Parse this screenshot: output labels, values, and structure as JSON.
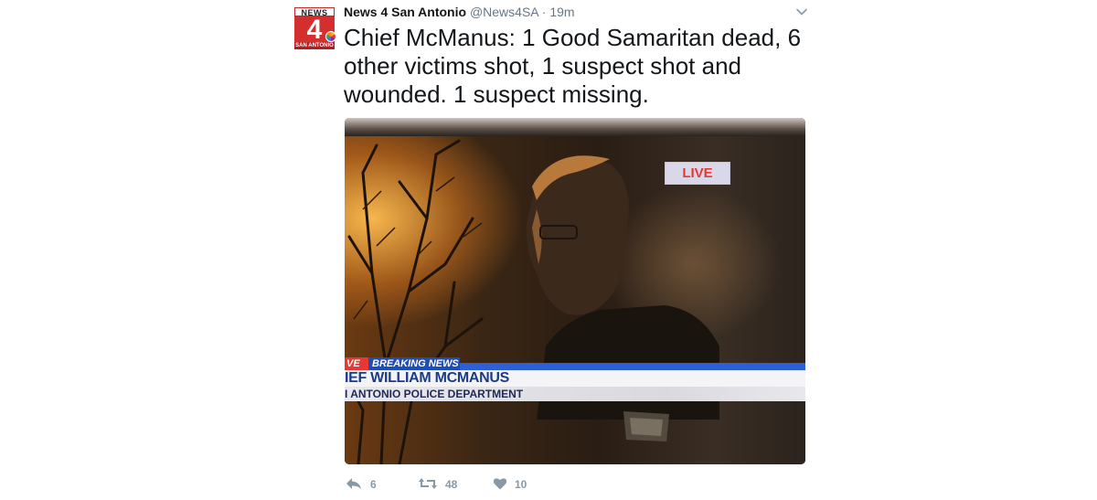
{
  "account": {
    "name": "News 4 San Antonio",
    "handle": "@News4SA",
    "separator": "·",
    "time": "19m",
    "logo": {
      "top_text": "NEWS",
      "number": "4",
      "bottom_text": "SAN ANTONIO"
    }
  },
  "tweet": {
    "text": "Chief McManus: 1 Good Samaritan dead, 6 other victims shot, 1 suspect shot and wounded. 1 suspect missing."
  },
  "media": {
    "live_chip": "LIVE",
    "lower_third": {
      "live_fragment": "VE",
      "breaking_label": "BREAKING NEWS",
      "name_text": "IEF WILLIAM MCMANUS",
      "dept_text": "I ANTONIO POLICE DEPARTMENT"
    }
  },
  "actions": {
    "reply_count": "6",
    "retweet_count": "48",
    "like_count": "10"
  },
  "colors": {
    "text": "#14171a",
    "muted": "#657786",
    "action_icon": "#8899a6",
    "live_red": "#e53935",
    "breaking_blue": "#1e4db7",
    "logo_red": "#d32f2f"
  },
  "icons": [
    "caret-down-icon",
    "reply-icon",
    "retweet-icon",
    "heart-icon"
  ]
}
